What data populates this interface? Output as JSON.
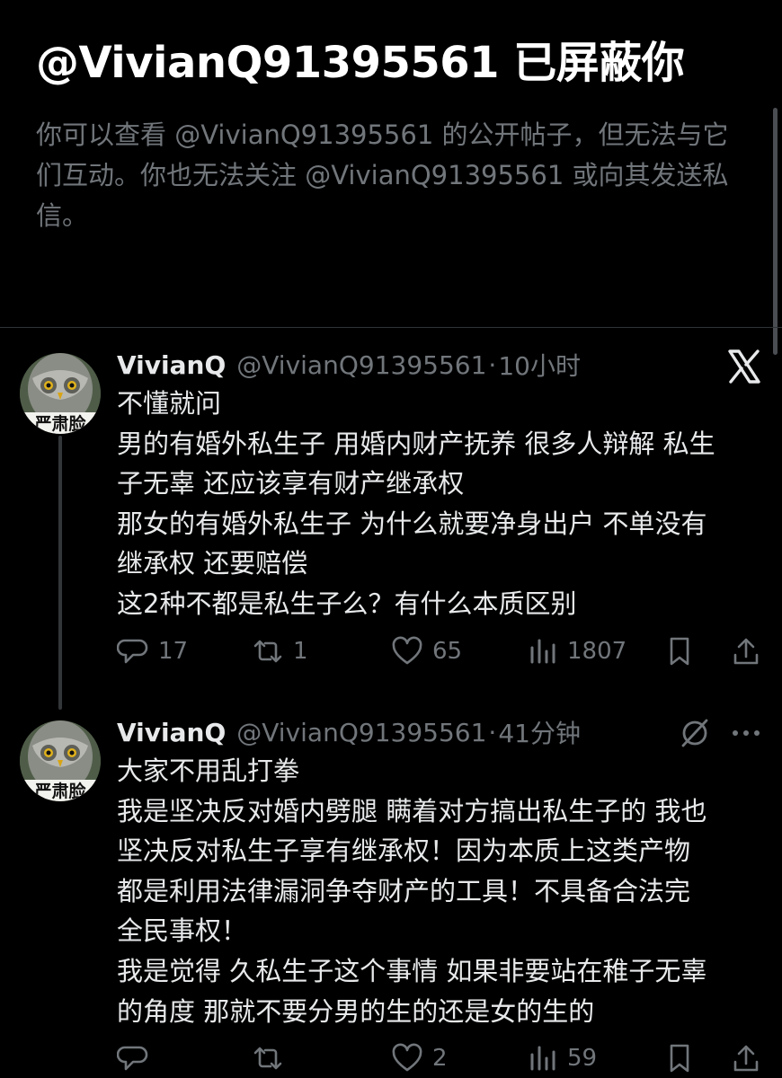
{
  "banner": {
    "title": "@VivianQ91395561 已屏蔽你",
    "lines": [
      "你可以查看 @VivianQ91395561 的公开帖子，但无法与它",
      "们互动。你也无法关注 @VivianQ91395561 或向其发送私",
      "信。"
    ]
  },
  "tweets": [
    {
      "name": "VivianQ",
      "handle": "@VivianQ91395561",
      "dot": "·",
      "time": "10小时",
      "avatar_text": "严肃脸",
      "corner_icon": "x-logo-icon",
      "lines": [
        "不懂就问",
        "男的有婚外私生子 用婚内财产抚养 很多人辩解 私生",
        "子无辜 还应该享有财产继承权",
        "那女的有婚外私生子 为什么就要净身出户 不单没有",
        "继承权 还要赔偿",
        "这2种不都是私生子么？有什么本质区别"
      ],
      "actions": {
        "reply_count": "17",
        "retweet_count": "1",
        "like_count": "65",
        "view_count": "1807"
      }
    },
    {
      "name": "VivianQ",
      "handle": "@VivianQ91395561",
      "dot": "·",
      "time": "41分钟",
      "avatar_text": "严肃脸",
      "corner_icon": "grok-icon",
      "lines": [
        "大家不用乱打拳",
        "我是坚决反对婚内劈腿 瞒着对方搞出私生子的 我也",
        "坚决反对私生子享有继承权！因为本质上这类产物",
        "都是利用法律漏洞争夺财产的工具！不具备合法完",
        "全民事权！",
        "我是觉得 久私生子这个事情 如果非要站在稚子无辜",
        "的角度 那就不要分男的生的还是女的生的"
      ],
      "actions": {
        "reply_count": "",
        "retweet_count": "",
        "like_count": "2",
        "view_count": "59"
      }
    }
  ],
  "colors": {
    "background": "#000000",
    "text": "#e7e9ea",
    "muted": "#71767b",
    "divider": "#2f3336"
  }
}
